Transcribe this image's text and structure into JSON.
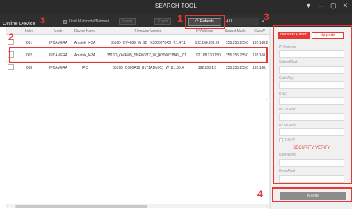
{
  "window": {
    "title": "SEARCH TOOL",
    "controls": [
      "▼",
      "—",
      "▢",
      "✕"
    ]
  },
  "toolbar": {
    "online_label": "Online Device",
    "online_count": "3",
    "onvif_label": "Onvif Multimodel/Netmast",
    "btn_import": "Import",
    "btn_export": "Export",
    "refresh_label": "Refresh",
    "filter_value": "ALL"
  },
  "annotations": {
    "a1": "1",
    "a2": "2",
    "a3": "3",
    "a4": "4",
    "color": "#e53935"
  },
  "table": {
    "headers": [
      "Index",
      "Model",
      "Device Name",
      "Firmware Version",
      "IP Address",
      "Subnet Mask",
      "GateW"
    ],
    "rows": [
      {
        "index": "001",
        "model": "IPCAMERA",
        "name": "Amatek_I4SA",
        "firmware": "3516D_OV4689_W_SD_[K300027845]_7.1.47.1",
        "ip": "192.168.230.69",
        "mask": "255.255.255.0",
        "gateway": "192.168.2"
      },
      {
        "index": "002",
        "model": "IPCAMERA",
        "name": "Amatek_I4ZA",
        "firmware": "3516D_OV4689_SNEWPTZ_W_[K300027845]_7.1...",
        "ip": "192.168.230.150",
        "mask": "255.255.255.0",
        "gateway": "192.168.2"
      },
      {
        "index": "003",
        "model": "IPCAMERA",
        "name": "IPC",
        "firmware": "3516D_OS05A10_B1T1A1M6C1_W_8.1.35.4",
        "ip": "192.168.1.5",
        "mask": "255.255.255.0",
        "gateway": "192.168."
      }
    ]
  },
  "panel": {
    "tab_network": "NetWork Param",
    "tab_upgrade": "Upgrade",
    "ip_label": "IP Address",
    "subnet_label": "SubnetMask",
    "gateway_label": "GateWay",
    "dns_label": "DNS",
    "http_label": "HTTP Port",
    "rtsp_label": "RTSP Port",
    "dhcp_label": "DHCP",
    "security_title": "SECURITY VERIFY",
    "username_label": "UserName",
    "password_label": "PassWord",
    "modify_label": "Modify"
  },
  "icons": {
    "refresh": "refresh-icon",
    "collapse": "chevron-right-icon"
  },
  "colors": {
    "accent": "#e53935",
    "titlebar": "#2b2b2b",
    "toolbar": "#2f2f2f"
  }
}
